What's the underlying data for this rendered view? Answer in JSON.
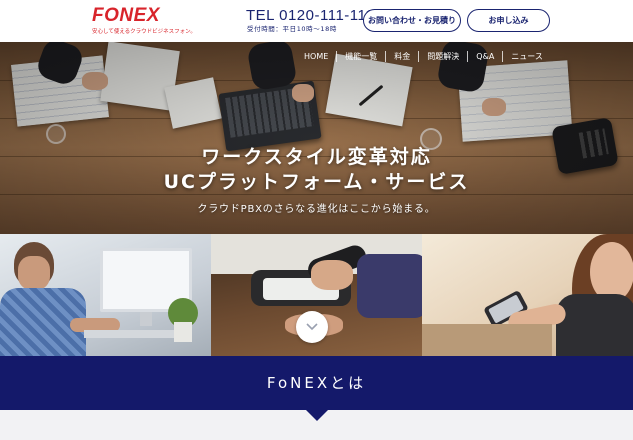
{
  "header": {
    "logo_text": "FONEX",
    "tagline": "安心して使えるクラウドビジネスフォン。",
    "tel": "TEL 0120-111-111",
    "hours": "受付時間：平日10時〜18時",
    "contact_button": "お問い合わせ・お見積り",
    "apply_button": "お申し込み"
  },
  "nav": {
    "items": [
      "HOME",
      "機能一覧",
      "料金",
      "問題解決",
      "Q&A",
      "ニュース"
    ]
  },
  "hero": {
    "title_line1": "ワークスタイル変革対応",
    "title_line2": "UCプラットフォーム・サービス",
    "subtitle": "クラウドPBXのさらなる進化はここから始まる。"
  },
  "section": {
    "title": "FoNEXとは"
  },
  "icons": {
    "scroll": "chevron-down-icon"
  },
  "colors": {
    "brand_red": "#d8242b",
    "navy": "#14196a"
  }
}
